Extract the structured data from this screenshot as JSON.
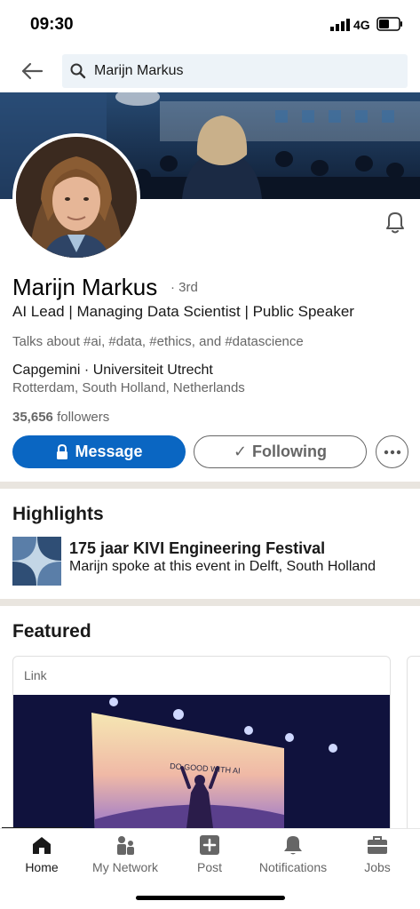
{
  "status_bar": {
    "time": "09:30",
    "network": "4G"
  },
  "search": {
    "query": "Marijn Markus"
  },
  "profile": {
    "name": "Marijn Markus",
    "degree": "· 3rd",
    "headline": "AI Lead | Managing Data Scientist | Public Speaker",
    "talks_about": "Talks about #ai, #data, #ethics, and #datascience",
    "company": "Capgemini · Universiteit Utrecht",
    "location": "Rotterdam, South Holland, Netherlands",
    "followers_count": "35,656",
    "followers_label": "followers"
  },
  "actions": {
    "message_label": "Message",
    "following_label": "Following"
  },
  "highlights": {
    "title": "Highlights",
    "item_title": "175 jaar KIVI Engineering Festival",
    "item_subtitle": "Marijn spoke at this event in Delft, South Holland"
  },
  "featured": {
    "title": "Featured",
    "card_label": "Link",
    "image_text": "DO GOOD WITH AI"
  },
  "nav": {
    "items": [
      {
        "label": "Home",
        "icon": "home-icon"
      },
      {
        "label": "My Network",
        "icon": "network-icon"
      },
      {
        "label": "Post",
        "icon": "post-icon"
      },
      {
        "label": "Notifications",
        "icon": "bell-icon"
      },
      {
        "label": "Jobs",
        "icon": "briefcase-icon"
      }
    ]
  },
  "colors": {
    "primary": "#0a66c2",
    "divider": "#e9e5df",
    "muted": "#666666"
  }
}
